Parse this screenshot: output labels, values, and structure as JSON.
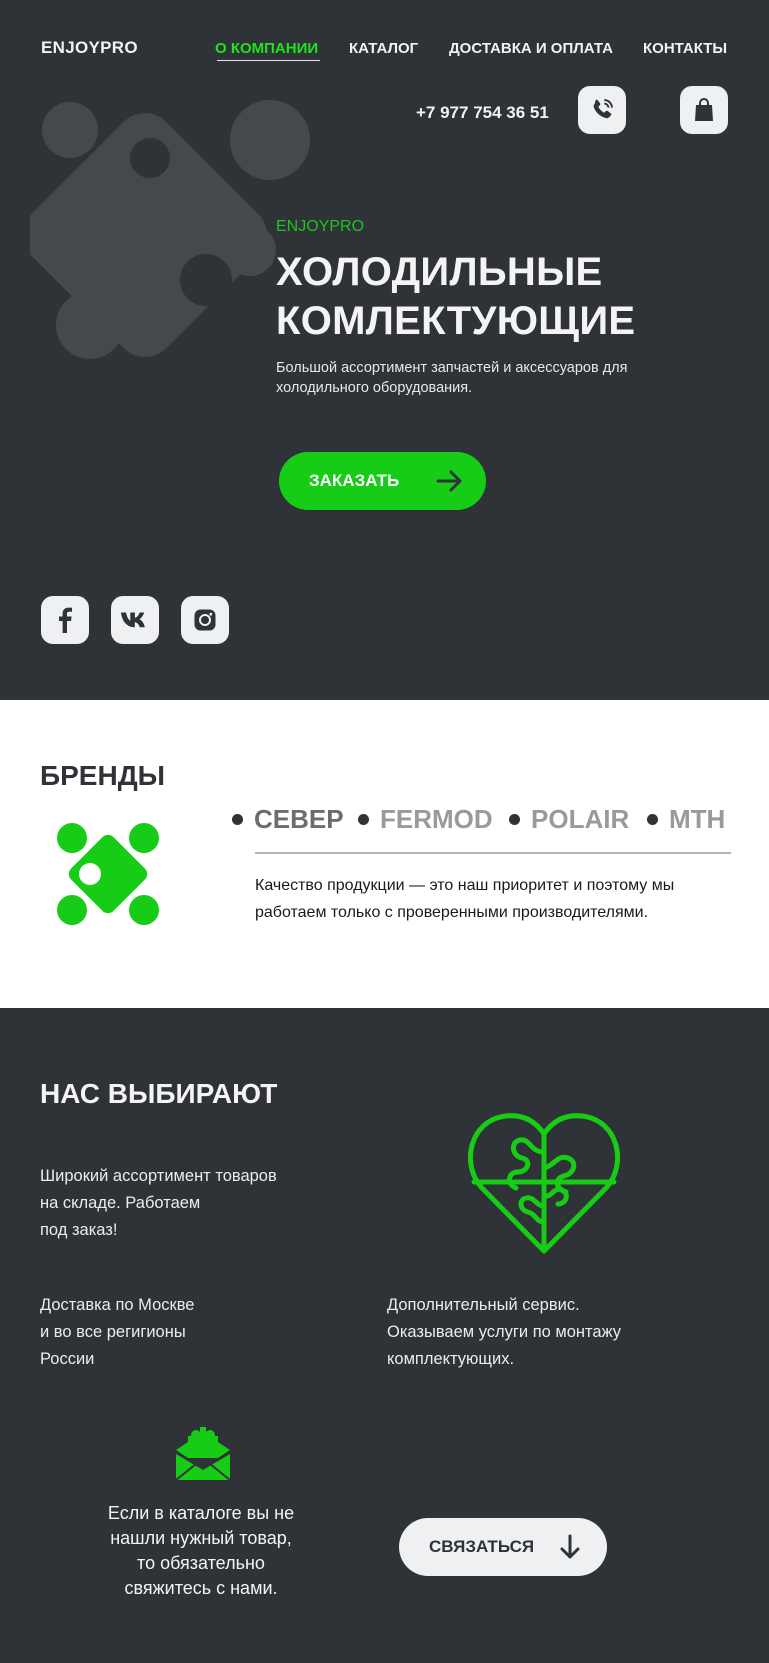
{
  "colors": {
    "dark_background": "#2f3236",
    "accent_green": "#16cc16",
    "light_button": "#eef0f2",
    "white": "#ffffff"
  },
  "header": {
    "logo": "ENJOYPRO",
    "nav": [
      {
        "label": "О КОМПАНИИ",
        "active": true
      },
      {
        "label": "КАТАЛОГ",
        "active": false
      },
      {
        "label": "ДОСТАВКА И ОПЛАТА",
        "active": false
      },
      {
        "label": "КОНТАКТЫ",
        "active": false
      }
    ],
    "phone": "+7 977 754 36 51",
    "icons": [
      "phone-icon",
      "shopping-bag-icon"
    ]
  },
  "hero": {
    "eyebrow": "ENJOYPRO",
    "title": "ХОЛОДИЛЬНЫЕ\nКОМЛЕКТУЮЩИЕ",
    "subtitle": "Большой ассортимент запчастей и аксессуаров для холодильного оборудования.",
    "order_button": "ЗАКАЗАТЬ",
    "socials": [
      "facebook-icon",
      "vk-icon",
      "instagram-icon"
    ]
  },
  "brands": {
    "title": "БРЕНДЫ",
    "items": [
      "СЕВЕР",
      "FERMOD",
      "POLAIR",
      "MTH"
    ],
    "text": "Качество продукции — это наш приоритет и поэтому мы работаем только с проверенными производителями."
  },
  "choose": {
    "title": "НАС ВЫБИРАЮТ",
    "feature_assortment": "Широкий ассортимент товаров\nна складе. Работаем\n под заказ!",
    "feature_delivery": "Доставка по Москве\nи во все регигионы\nРоссии",
    "feature_service": "Дополнительный сервис.\nОказываем услуги по монтажу\nкомплектующих.",
    "cta_text": "Если в каталоге вы не\nнашли нужный  товар,\nто обязательно\nсвяжитесь с нами.",
    "contact_button": "СВЯЗАТЬСЯ"
  }
}
